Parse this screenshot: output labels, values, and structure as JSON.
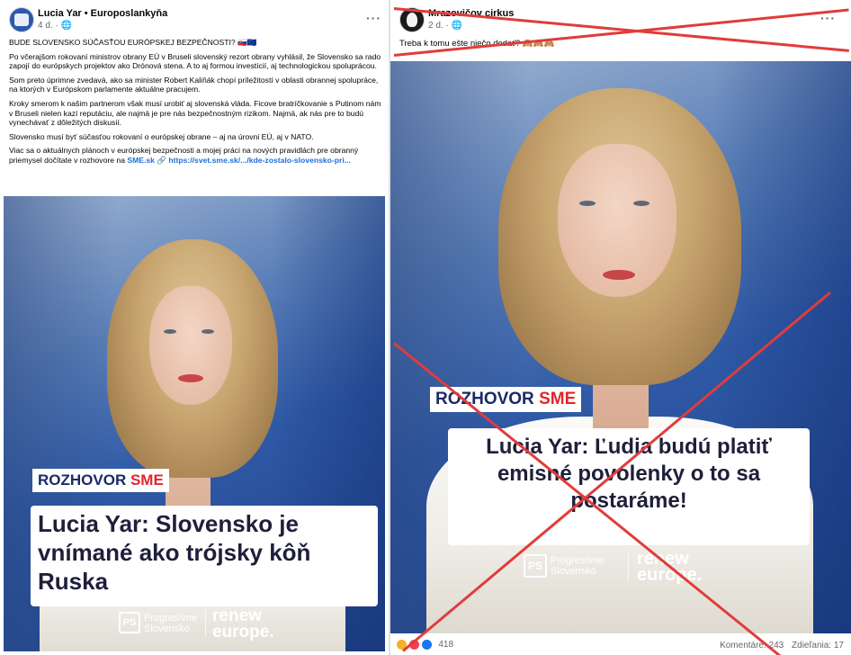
{
  "left_post": {
    "author": "Lucia Yar • Europoslankyňa",
    "meta": "4 d. · 🌐",
    "menu_label": "···",
    "paragraphs": [
      "BUDE SLOVENSKO SÚČASŤOU EURÓPSKEJ BEZPEČNOSTI? 🇸🇰🇪🇺",
      "Po včerajšom rokovaní ministrov obrany EÚ v Bruseli slovenský rezort obrany vyhlásil, že Slovensko sa rado zapojí do európskych projektov ako Drónová stena. A to aj formou investícií, aj technologickou spoluprácou.",
      "Som preto úprimne zvedavá, ako sa minister Robert Kaliňák chopí príležitostí v oblasti obrannej spolupráce, na ktorých v Európskom parlamente aktuálne pracujem.",
      "Kroky smerom k našim partnerom však musí urobiť aj slovenská vláda. Ficove bratríčkovanie s Putinom nám v Bruseli nielen kazí reputáciu, ale najmä je pre nás bezpečnostným rizikom. Najmä, ak nás pre to budú vynechávať z dôležitých diskusií.",
      "Slovensko musí byť súčasťou rokovaní o európskej obrane – aj na úrovni EÚ, aj v NATO."
    ],
    "last_paragraph_text": "Viac sa o aktuálnych plánoch v európskej bezpečnosti a mojej práci na nových pravidlách pre obranný priemysel dočítate v rozhovore na ",
    "last_paragraph_link_source": "SME.sk",
    "last_paragraph_link_url": "🔗 https://svet.sme.sk/.../kde-zostalo-slovensko-pri...",
    "image": {
      "tag_rozhovor": "ROZHOVOR",
      "tag_sme": "SME",
      "headline": "Lucia Yar: Slovensko je vnímané ako trójsky kôň Ruska",
      "ps_logo": "PS",
      "ps_name_line1": "Progresívne",
      "ps_name_line2": "Slovensko",
      "renew_line1": "renew",
      "renew_line2": "europe."
    }
  },
  "right_post": {
    "author": "Mrazovičov cirkus",
    "meta": "2 d. · 🌐",
    "menu_label": "···",
    "text": "Treba k tomu ešte niečo dodať? 🙈🙈🙈",
    "image": {
      "tag_rozhovor": "ROZHOVOR",
      "tag_sme": "SME",
      "headline": "Lucia Yar: Ľudia budú platiť emisné povolenky o to sa postaráme!",
      "ps_logo": "PS",
      "ps_name_line1": "Progresívne",
      "ps_name_line2": "Slovensko",
      "renew_line1": "renew",
      "renew_line2": "europe."
    },
    "reaction_count": "418",
    "comments": "Komentáre: 243",
    "shares": "Zdieľania: 17"
  },
  "colors": {
    "cross_red": "#e03c3c",
    "sme_red": "#e2262c",
    "rozhovor_navy": "#1b2a67",
    "link_blue": "#216fdb"
  }
}
